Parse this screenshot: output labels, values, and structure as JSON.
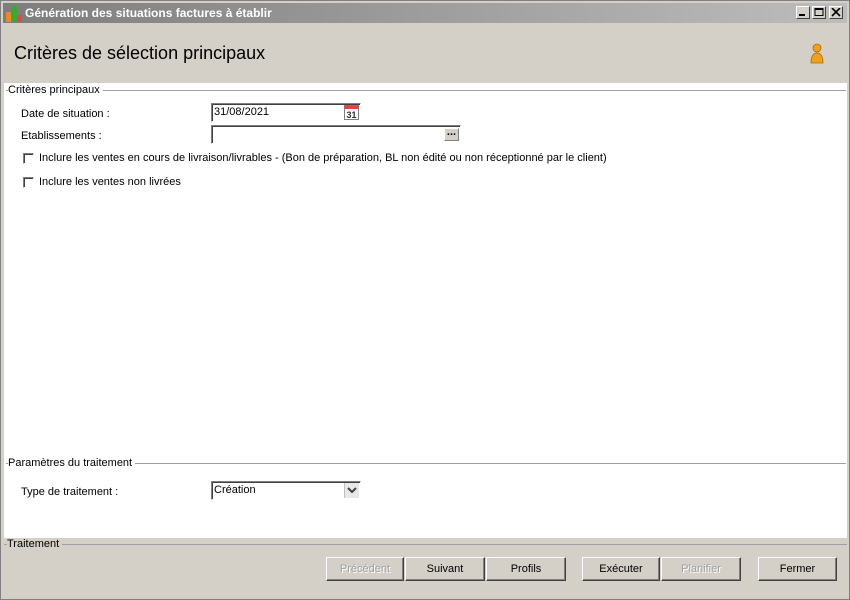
{
  "window": {
    "title": "Génération des situations factures à établir"
  },
  "header": {
    "title": "Critères de sélection principaux"
  },
  "main_criteria": {
    "legend": "Critères principaux",
    "date_label": "Date de situation :",
    "date_value": "31/08/2021",
    "calendar_day": "31",
    "etab_label": "Etablissements :",
    "etab_value": "",
    "check1_label": "Inclure les ventes en cours de livraison/livrables - (Bon de préparation, BL non édité ou non réceptionné par le client)",
    "check1_checked": false,
    "check2_label": "Inclure les ventes non livrées",
    "check2_checked": false
  },
  "processing_params": {
    "legend": "Paramètres du traitement",
    "type_label": "Type de traitement :",
    "type_value": "Création"
  },
  "footer": {
    "legend": "Traitement",
    "buttons": {
      "precedent": "Précédent",
      "suivant": "Suivant",
      "profils": "Profils",
      "executer": "Exécuter",
      "planifier": "Planifier",
      "fermer": "Fermer"
    }
  }
}
